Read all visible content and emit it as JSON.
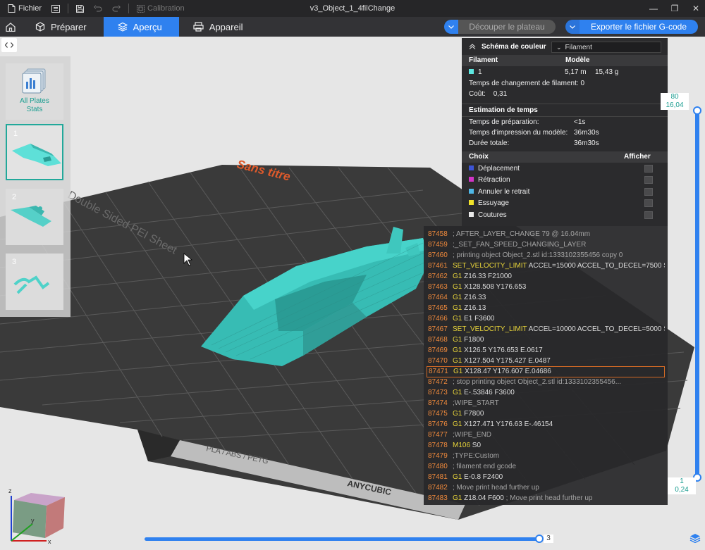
{
  "titlebar": {
    "file_label": "Fichier",
    "calibration_label": "Calibration",
    "window_title": "v3_Object_1_4filChange"
  },
  "tabs": {
    "prepare": "Préparer",
    "preview": "Aperçu",
    "device": "Appareil"
  },
  "actions": {
    "slice_plate": "Découper le plateau",
    "export_gcode": "Exporter le fichier G-code"
  },
  "scene": {
    "plate_name": "Sans titre",
    "plate_side_text": "Double Sided PEI Sheet",
    "plate_front_text": "PLA / ABS / PETG",
    "brand_text": "ANYCUBIC"
  },
  "plates": {
    "all_stats_line1": "All Plates",
    "all_stats_line2": "Stats",
    "items": [
      {
        "num": "1"
      },
      {
        "num": "2"
      },
      {
        "num": "3"
      }
    ]
  },
  "legend": {
    "title": "Schéma de couleur",
    "scheme_value": "Filament",
    "col_filament": "Filament",
    "col_model": "Modèle",
    "filament_index": "1",
    "filament_length": "5,17 m",
    "filament_weight": "15,43 g",
    "filament_color": "#5ee8e1",
    "change_time_label": "Temps de changement de filament:",
    "change_time_value": "0",
    "cost_label": "Coût:",
    "cost_value": "0,31",
    "estimation_title": "Estimation de temps",
    "prep_label": "Temps de préparation:",
    "prep_value": "<1s",
    "model_time_label": "Temps d'impression du modèle:",
    "model_time_value": "36m30s",
    "total_label": "Durée totale:",
    "total_value": "36m30s",
    "choice_label": "Choix",
    "show_label": "Afficher",
    "options": [
      {
        "label": "Déplacement",
        "color": "#3c54d6"
      },
      {
        "label": "Rétraction",
        "color": "#d234c8"
      },
      {
        "label": "Annuler le retrait",
        "color": "#4fb7e6"
      },
      {
        "label": "Essuyage",
        "color": "#f0e22a"
      },
      {
        "label": "Coutures",
        "color": "#e8e8e8"
      }
    ]
  },
  "gcode": [
    {
      "n": "87458",
      "cmd": "",
      "args": "",
      "comment": "; AFTER_LAYER_CHANGE 79 @ 16.04mm"
    },
    {
      "n": "87459",
      "cmd": "",
      "args": "",
      "comment": ";_SET_FAN_SPEED_CHANGING_LAYER"
    },
    {
      "n": "87460",
      "cmd": "",
      "args": "",
      "comment": "; printing object Object_2.stl id:1333102355456 copy 0"
    },
    {
      "n": "87461",
      "cmd": "SET_VELOCITY_LIMIT",
      "args": " ACCEL=15000 ACCEL_TO_DECEL=7500 S...",
      "comment": ""
    },
    {
      "n": "87462",
      "cmd": "G1",
      "args": " Z16.33 F21000",
      "comment": ""
    },
    {
      "n": "87463",
      "cmd": "G1",
      "args": " X128.508 Y176.653",
      "comment": ""
    },
    {
      "n": "87464",
      "cmd": "G1",
      "args": " Z16.33",
      "comment": ""
    },
    {
      "n": "87465",
      "cmd": "G1",
      "args": " Z16.13",
      "comment": ""
    },
    {
      "n": "87466",
      "cmd": "G1",
      "args": " E1 F3600",
      "comment": ""
    },
    {
      "n": "87467",
      "cmd": "SET_VELOCITY_LIMIT",
      "args": " ACCEL=10000 ACCEL_TO_DECEL=5000 S...",
      "comment": ""
    },
    {
      "n": "87468",
      "cmd": "G1",
      "args": " F1800",
      "comment": ""
    },
    {
      "n": "87469",
      "cmd": "G1",
      "args": " X126.5 Y176.653 E.0617",
      "comment": ""
    },
    {
      "n": "87470",
      "cmd": "G1",
      "args": " X127.504 Y175.427 E.0487",
      "comment": ""
    },
    {
      "n": "87471",
      "cmd": "G1",
      "args": " X128.47 Y176.607 E.04686",
      "comment": ""
    },
    {
      "n": "87472",
      "cmd": "",
      "args": "",
      "comment": "; stop printing object Object_2.stl id:1333102355456..."
    },
    {
      "n": "87473",
      "cmd": "G1",
      "args": " E-.53846 F3600",
      "comment": ""
    },
    {
      "n": "87474",
      "cmd": "",
      "args": "",
      "comment": ";WIPE_START"
    },
    {
      "n": "87475",
      "cmd": "G1",
      "args": " F7800",
      "comment": ""
    },
    {
      "n": "87476",
      "cmd": "G1",
      "args": " X127.471 Y176.63 E-.46154",
      "comment": ""
    },
    {
      "n": "87477",
      "cmd": "",
      "args": "",
      "comment": ";WIPE_END"
    },
    {
      "n": "87478",
      "cmd": "M106",
      "args": " S0",
      "comment": ""
    },
    {
      "n": "87479",
      "cmd": "",
      "args": "",
      "comment": ";TYPE:Custom"
    },
    {
      "n": "87480",
      "cmd": "",
      "args": "",
      "comment": "; filament end gcode"
    },
    {
      "n": "87481",
      "cmd": "G1",
      "args": " E-0.8 F2400",
      "comment": ""
    },
    {
      "n": "87482",
      "cmd": "",
      "args": "",
      "comment": "; Move print head further up"
    },
    {
      "n": "87483",
      "cmd": "G1",
      "args": " Z18.04 F600",
      "comment": " ; Move print head further up"
    }
  ],
  "gcode_highlight": "87471",
  "layer_slider": {
    "top_layer": "80",
    "top_height": "16,04",
    "bottom_layer": "1",
    "bottom_height": "0,24"
  },
  "move_slider": {
    "value": "3"
  },
  "axis": {
    "x": "x",
    "y": "y",
    "z": "z"
  }
}
